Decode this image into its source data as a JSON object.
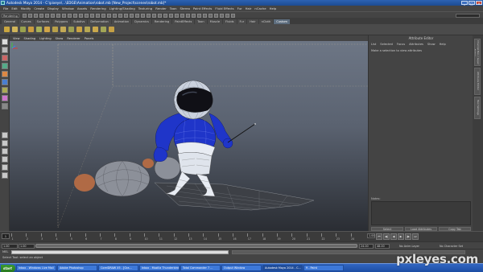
{
  "window": {
    "title": "Autodesk Maya 2014 - C:\\pixeye\\...\\EDGE\\Animation\\robot.mb [New_Project\\scenes\\robot.mb]*"
  },
  "menubar": {
    "items": [
      "File",
      "Edit",
      "Modify",
      "Create",
      "Display",
      "Window",
      "Assets",
      "Rendering",
      "Lighting/Shading",
      "Texturing",
      "Render",
      "Toon",
      "Stereo",
      "Paint Effects",
      "Fluid Effects",
      "Fur",
      "Hair",
      "nCache",
      "Help"
    ]
  },
  "statusline": {
    "mode": "Rendering"
  },
  "shelf": {
    "tabs": [
      "General",
      "Curves",
      "Surfaces",
      "Polygons",
      "Subdivs",
      "Deformation",
      "Animation",
      "Dynamics",
      "Rendering",
      "PaintEffects",
      "Toon",
      "Muscle",
      "Fluids",
      "Fur",
      "Hair",
      "nCloth",
      "Custom"
    ],
    "active_tab": "Custom"
  },
  "viewport": {
    "menu": [
      "View",
      "Shading",
      "Lighting",
      "Show",
      "Renderer",
      "Panels"
    ],
    "camera_label": "persp"
  },
  "attribute_editor": {
    "title": "Attribute Editor",
    "menu": [
      "List",
      "Selected",
      "Focus",
      "Attributes",
      "Show",
      "Help"
    ],
    "message": "Make a selection to view attributes",
    "notes_label": "Notes:",
    "buttons": [
      "Select",
      "Load Attributes",
      "Copy Tab"
    ]
  },
  "side_tabs": [
    "Channel Box / Layer Editor",
    "Attribute Editor",
    "Tool Settings"
  ],
  "timeslider": {
    "current_frame": "1",
    "tick_labels": [
      "1",
      "2",
      "3",
      "4",
      "5",
      "6",
      "7",
      "8",
      "9",
      "10",
      "11",
      "12",
      "13",
      "14",
      "15",
      "16",
      "17",
      "18",
      "19",
      "20",
      "21",
      "22",
      "23",
      "24"
    ],
    "end_frame": "1.00",
    "playback_icons": [
      "go-to-start",
      "step-back",
      "play-back",
      "play-forward",
      "step-forward",
      "go-to-end"
    ]
  },
  "rangeslider": {
    "start": "1.00",
    "start_inner": "1.00",
    "end_inner": "24.00",
    "end": "48.00",
    "anim_layer": "No Anim Layer",
    "char_set": "No Character Set"
  },
  "cmdline": {
    "label": "MEL"
  },
  "helpline": {
    "text": "Select Tool: select an object"
  },
  "taskbar": {
    "start_label": "start",
    "items": [
      "Inbox - Windows Live Mail",
      "Adobe Photoshop",
      "CorelDRAW X5 - [Gra...",
      "Inbox - Mozilla Thunderbird",
      "Total Commander 7 ...",
      "Output Window",
      "Autodesk Maya 2014 - C...",
      "9 - Paint"
    ]
  },
  "watermark": {
    "text": "pxleyes.com"
  },
  "colors": {
    "ui_bg": "#444444",
    "viewport_top": "#6d7685",
    "viewport_bottom": "#2a2d33",
    "robot_blue": "#1f35c9",
    "taskbar_blue": "#2458b8",
    "start_green": "#33882a"
  }
}
